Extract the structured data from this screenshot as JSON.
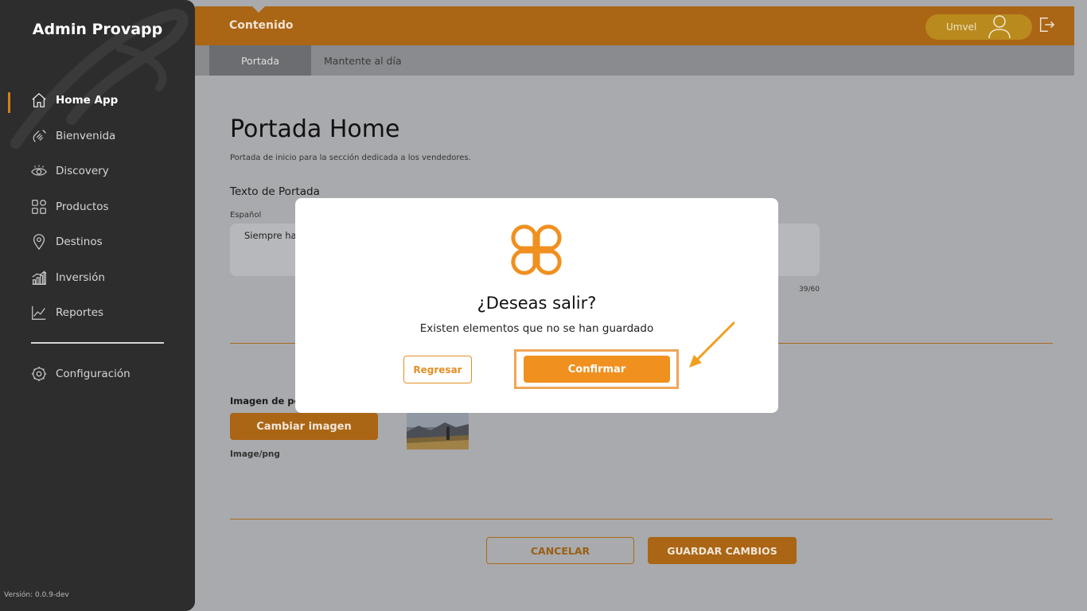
{
  "sidebar": {
    "brand": "Admin Provapp",
    "items": [
      {
        "label": "Home App",
        "icon": "home-icon",
        "active": true
      },
      {
        "label": "Bienvenida",
        "icon": "hand-wave-icon"
      },
      {
        "label": "Discovery",
        "icon": "eye-icon"
      },
      {
        "label": "Productos",
        "icon": "grid-icon"
      },
      {
        "label": "Destinos",
        "icon": "map-pin-icon"
      },
      {
        "label": "Inversión",
        "icon": "bar-chart-icon"
      },
      {
        "label": "Reportes",
        "icon": "line-chart-icon"
      }
    ],
    "settings": {
      "label": "Configuración",
      "icon": "gear-icon"
    },
    "version": "Versión: 0.0.9-dev"
  },
  "header": {
    "section": "Contenido",
    "user_name": "Umvel",
    "accent": "#aa6515"
  },
  "tabs": [
    "Portada",
    "Mantente al día"
  ],
  "main": {
    "title": "Portada Home",
    "subtitle": "Portada de inicio para la sección dedicada a los vendedores.",
    "text_section_label": "Texto de Portada",
    "lang_label": "Español",
    "text_value": "Siempre hay",
    "counter": "39/60",
    "image_label": "Imagen de po",
    "change_image": "Cambiar imagen",
    "image_type": "Image/png",
    "cancel": "CANCELAR",
    "save": "GUARDAR CAMBIOS"
  },
  "modal": {
    "title": "¿Deseas salir?",
    "message": "Existen elementos que no se han guardado",
    "back": "Regresar",
    "confirm": "Confirmar",
    "accent": "#f0901f"
  }
}
